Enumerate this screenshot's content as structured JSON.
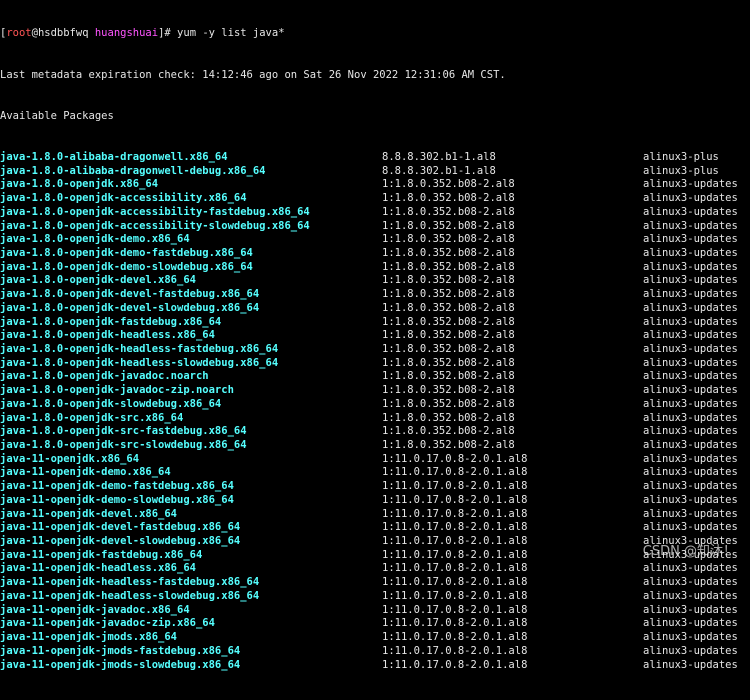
{
  "prompt": {
    "open_bracket": "[",
    "user": "root",
    "at": "@",
    "host": "hsdbbfwq",
    "path": "huangshuai",
    "close": "]# ",
    "command": "yum -y list java*"
  },
  "metadata_line": "Last metadata expiration check: 14:12:46 ago on Sat 26 Nov 2022 12:31:06 AM CST.",
  "available_header": "Available Packages",
  "packages": [
    {
      "name": "java-1.8.0-alibaba-dragonwell.x86_64",
      "version": "8.8.8.302.b1-1.al8",
      "repo": "alinux3-plus"
    },
    {
      "name": "java-1.8.0-alibaba-dragonwell-debug.x86_64",
      "version": "8.8.8.302.b1-1.al8",
      "repo": "alinux3-plus"
    },
    {
      "name": "java-1.8.0-openjdk.x86_64",
      "version": "1:1.8.0.352.b08-2.al8",
      "repo": "alinux3-updates"
    },
    {
      "name": "java-1.8.0-openjdk-accessibility.x86_64",
      "version": "1:1.8.0.352.b08-2.al8",
      "repo": "alinux3-updates"
    },
    {
      "name": "java-1.8.0-openjdk-accessibility-fastdebug.x86_64",
      "version": "1:1.8.0.352.b08-2.al8",
      "repo": "alinux3-updates"
    },
    {
      "name": "java-1.8.0-openjdk-accessibility-slowdebug.x86_64",
      "version": "1:1.8.0.352.b08-2.al8",
      "repo": "alinux3-updates"
    },
    {
      "name": "java-1.8.0-openjdk-demo.x86_64",
      "version": "1:1.8.0.352.b08-2.al8",
      "repo": "alinux3-updates"
    },
    {
      "name": "java-1.8.0-openjdk-demo-fastdebug.x86_64",
      "version": "1:1.8.0.352.b08-2.al8",
      "repo": "alinux3-updates"
    },
    {
      "name": "java-1.8.0-openjdk-demo-slowdebug.x86_64",
      "version": "1:1.8.0.352.b08-2.al8",
      "repo": "alinux3-updates"
    },
    {
      "name": "java-1.8.0-openjdk-devel.x86_64",
      "version": "1:1.8.0.352.b08-2.al8",
      "repo": "alinux3-updates"
    },
    {
      "name": "java-1.8.0-openjdk-devel-fastdebug.x86_64",
      "version": "1:1.8.0.352.b08-2.al8",
      "repo": "alinux3-updates"
    },
    {
      "name": "java-1.8.0-openjdk-devel-slowdebug.x86_64",
      "version": "1:1.8.0.352.b08-2.al8",
      "repo": "alinux3-updates"
    },
    {
      "name": "java-1.8.0-openjdk-fastdebug.x86_64",
      "version": "1:1.8.0.352.b08-2.al8",
      "repo": "alinux3-updates"
    },
    {
      "name": "java-1.8.0-openjdk-headless.x86_64",
      "version": "1:1.8.0.352.b08-2.al8",
      "repo": "alinux3-updates"
    },
    {
      "name": "java-1.8.0-openjdk-headless-fastdebug.x86_64",
      "version": "1:1.8.0.352.b08-2.al8",
      "repo": "alinux3-updates"
    },
    {
      "name": "java-1.8.0-openjdk-headless-slowdebug.x86_64",
      "version": "1:1.8.0.352.b08-2.al8",
      "repo": "alinux3-updates"
    },
    {
      "name": "java-1.8.0-openjdk-javadoc.noarch",
      "version": "1:1.8.0.352.b08-2.al8",
      "repo": "alinux3-updates"
    },
    {
      "name": "java-1.8.0-openjdk-javadoc-zip.noarch",
      "version": "1:1.8.0.352.b08-2.al8",
      "repo": "alinux3-updates"
    },
    {
      "name": "java-1.8.0-openjdk-slowdebug.x86_64",
      "version": "1:1.8.0.352.b08-2.al8",
      "repo": "alinux3-updates"
    },
    {
      "name": "java-1.8.0-openjdk-src.x86_64",
      "version": "1:1.8.0.352.b08-2.al8",
      "repo": "alinux3-updates"
    },
    {
      "name": "java-1.8.0-openjdk-src-fastdebug.x86_64",
      "version": "1:1.8.0.352.b08-2.al8",
      "repo": "alinux3-updates"
    },
    {
      "name": "java-1.8.0-openjdk-src-slowdebug.x86_64",
      "version": "1:1.8.0.352.b08-2.al8",
      "repo": "alinux3-updates"
    },
    {
      "name": "java-11-openjdk.x86_64",
      "version": "1:11.0.17.0.8-2.0.1.al8",
      "repo": "alinux3-updates"
    },
    {
      "name": "java-11-openjdk-demo.x86_64",
      "version": "1:11.0.17.0.8-2.0.1.al8",
      "repo": "alinux3-updates"
    },
    {
      "name": "java-11-openjdk-demo-fastdebug.x86_64",
      "version": "1:11.0.17.0.8-2.0.1.al8",
      "repo": "alinux3-updates"
    },
    {
      "name": "java-11-openjdk-demo-slowdebug.x86_64",
      "version": "1:11.0.17.0.8-2.0.1.al8",
      "repo": "alinux3-updates"
    },
    {
      "name": "java-11-openjdk-devel.x86_64",
      "version": "1:11.0.17.0.8-2.0.1.al8",
      "repo": "alinux3-updates"
    },
    {
      "name": "java-11-openjdk-devel-fastdebug.x86_64",
      "version": "1:11.0.17.0.8-2.0.1.al8",
      "repo": "alinux3-updates"
    },
    {
      "name": "java-11-openjdk-devel-slowdebug.x86_64",
      "version": "1:11.0.17.0.8-2.0.1.al8",
      "repo": "alinux3-updates"
    },
    {
      "name": "java-11-openjdk-fastdebug.x86_64",
      "version": "1:11.0.17.0.8-2.0.1.al8",
      "repo": "alinux3-updates"
    },
    {
      "name": "java-11-openjdk-headless.x86_64",
      "version": "1:11.0.17.0.8-2.0.1.al8",
      "repo": "alinux3-updates"
    },
    {
      "name": "java-11-openjdk-headless-fastdebug.x86_64",
      "version": "1:11.0.17.0.8-2.0.1.al8",
      "repo": "alinux3-updates"
    },
    {
      "name": "java-11-openjdk-headless-slowdebug.x86_64",
      "version": "1:11.0.17.0.8-2.0.1.al8",
      "repo": "alinux3-updates"
    },
    {
      "name": "java-11-openjdk-javadoc.x86_64",
      "version": "1:11.0.17.0.8-2.0.1.al8",
      "repo": "alinux3-updates"
    },
    {
      "name": "java-11-openjdk-javadoc-zip.x86_64",
      "version": "1:11.0.17.0.8-2.0.1.al8",
      "repo": "alinux3-updates"
    },
    {
      "name": "java-11-openjdk-jmods.x86_64",
      "version": "1:11.0.17.0.8-2.0.1.al8",
      "repo": "alinux3-updates"
    },
    {
      "name": "java-11-openjdk-jmods-fastdebug.x86_64",
      "version": "1:11.0.17.0.8-2.0.1.al8",
      "repo": "alinux3-updates"
    },
    {
      "name": "java-11-openjdk-jmods-slowdebug.x86_64",
      "version": "1:11.0.17.0.8-2.0.1.al8",
      "repo": "alinux3-updates"
    }
  ],
  "watermark": "CSDN @知沐！",
  "colors": {
    "background": "#000000",
    "text": "#e6e6e6",
    "package_name": "#55ffff",
    "prompt_user": "#ff5555",
    "prompt_path": "#ff55ff"
  }
}
